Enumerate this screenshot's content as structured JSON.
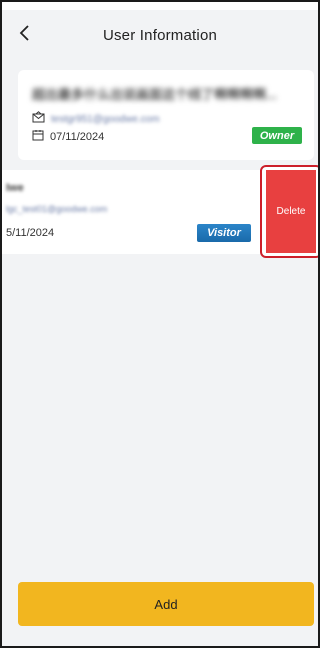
{
  "header": {
    "title": "User Information"
  },
  "users": [
    {
      "name": "超出最多什么出说画面这个线了啊啊啊啊...",
      "email": "testgr951@goodwe.com",
      "date": "07/11/2024",
      "role": "Owner",
      "role_color": "#2eb24a"
    },
    {
      "name": "Iwe",
      "email": "lgc_test01@goodwe.com",
      "date": "5/11/2024",
      "role": "Visitor",
      "role_color": "#1f75bb"
    }
  ],
  "actions": {
    "delete_label": "Delete",
    "delete_color": "#e84040",
    "add_label": "Add",
    "add_color": "#f2b61f"
  },
  "icons": {
    "back": "chevron-left-icon",
    "email": "envelope-icon",
    "date": "calendar-icon"
  }
}
